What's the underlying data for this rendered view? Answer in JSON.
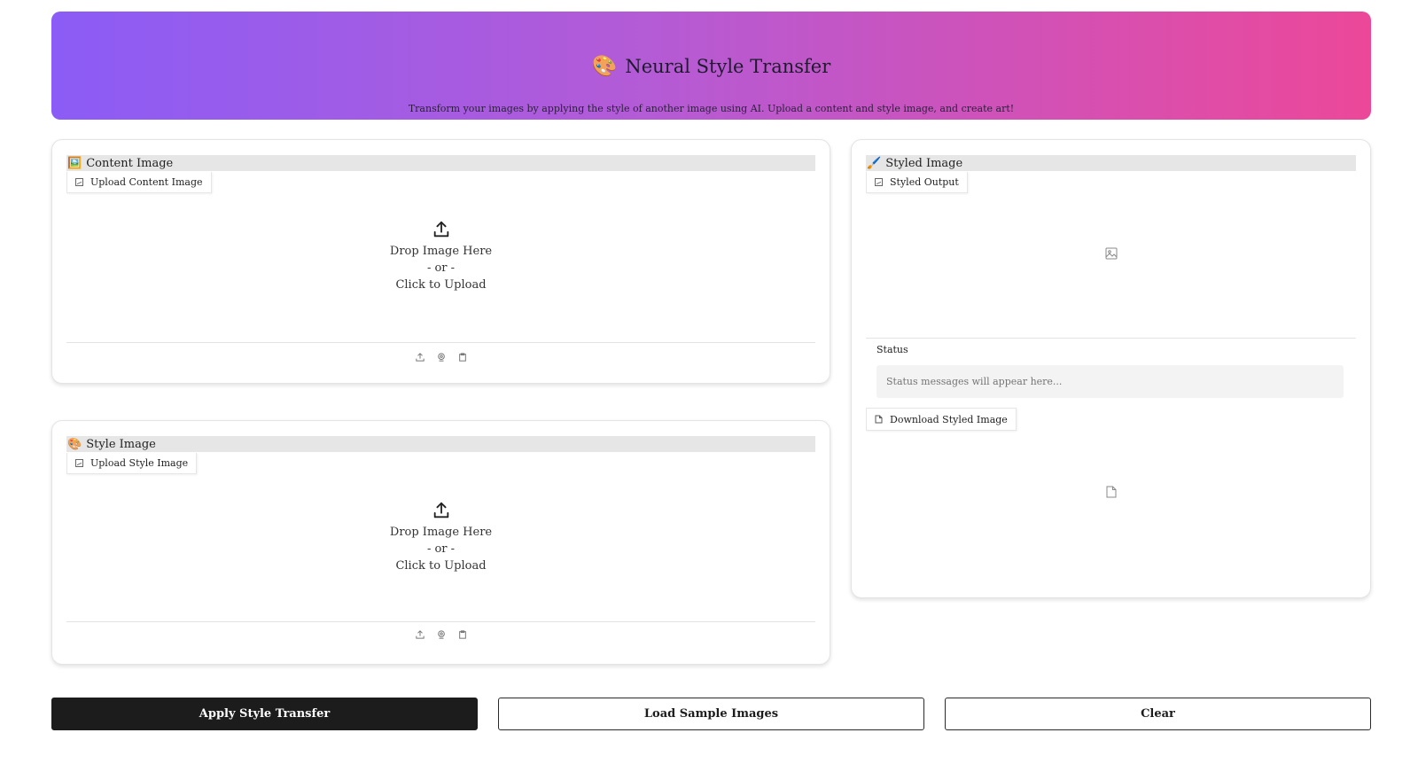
{
  "header": {
    "icon": "🎨",
    "title": "Neural Style Transfer",
    "subtitle": "Transform your images by applying the style of another image using AI. Upload a content and style image, and create art!",
    "gradient_from": "#8b5cf6",
    "gradient_to": "#ec4899"
  },
  "content_panel": {
    "label_icon": "🖼️",
    "label": "Content Image",
    "tab_label": "Upload Content Image",
    "drop_line1": "Drop Image Here",
    "drop_line2": "- or -",
    "drop_line3": "Click to Upload",
    "toolbar_icons": [
      "upload-icon",
      "webcam-icon",
      "clipboard-icon"
    ]
  },
  "style_panel": {
    "label_icon": "🎨",
    "label": "Style Image",
    "tab_label": "Upload Style Image",
    "drop_line1": "Drop Image Here",
    "drop_line2": "- or -",
    "drop_line3": "Click to Upload",
    "toolbar_icons": [
      "upload-icon",
      "webcam-icon",
      "clipboard-icon"
    ]
  },
  "output_panel": {
    "label_icon": "🖌️",
    "label": "Styled Image",
    "tab_label": "Styled Output",
    "status_label": "Status",
    "status_placeholder": "Status messages will appear here...",
    "download_label": "Download Styled Image"
  },
  "actions": {
    "apply_label": "Apply Style Transfer",
    "sample_label": "Load Sample Images",
    "clear_label": "Clear"
  }
}
